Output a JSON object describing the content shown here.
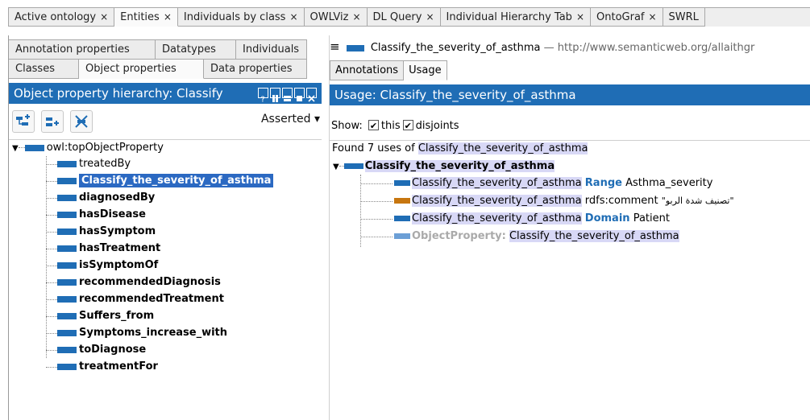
{
  "top_tabs": [
    {
      "label": "Active ontology",
      "close": "×"
    },
    {
      "label": "Entities",
      "close": "×"
    },
    {
      "label": "Individuals by class",
      "close": "×"
    },
    {
      "label": "OWLViz",
      "close": "×"
    },
    {
      "label": "DL Query",
      "close": "×"
    },
    {
      "label": "Individual Hierarchy Tab",
      "close": "×"
    },
    {
      "label": "OntoGraf",
      "close": "×"
    },
    {
      "label": "SWRL",
      "close": ""
    }
  ],
  "left": {
    "subtabs_row1": [
      "Annotation properties",
      "Datatypes",
      "Individuals"
    ],
    "subtabs_row2": [
      "Classes",
      "Object properties",
      "Data properties"
    ],
    "header": "Object property hierarchy: Classify",
    "asserted": "Asserted",
    "tree": {
      "root": "owl:topObjectProperty",
      "children": [
        "treatedBy",
        "Classify_the_severity_of_asthma",
        "diagnosedBy",
        "hasDisease",
        "hasSymptom",
        "hasTreatment",
        "isSymptomOf",
        "recommendedDiagnosis",
        "recommendedTreatment",
        "Suffers_from",
        "Symptoms_increase_with",
        "toDiagnose",
        "treatmentFor"
      ]
    }
  },
  "right": {
    "menu_glyph": "≡",
    "entity_name": "Classify_the_severity_of_asthma",
    "entity_sep": "—",
    "entity_uri": "http://www.semanticweb.org/allaithgr",
    "tabs": [
      "Annotations",
      "Usage"
    ],
    "header": "Usage: Classify_the_severity_of_asthma",
    "show_label": "Show:",
    "show_this": "this",
    "show_disjoints": "disjoints",
    "found_prefix": "Found 7 uses of",
    "found_entity": "Classify_the_severity_of_asthma",
    "usage_root": "Classify_the_severity_of_asthma",
    "usages": [
      {
        "subject": "Classify_the_severity_of_asthma",
        "predicate": "Range",
        "object": "Asthma_severity"
      },
      {
        "subject": "Classify_the_severity_of_asthma",
        "predicate": "rdfs:comment",
        "object": "\"تصنيف شدة الربو\""
      },
      {
        "subject": "Classify_the_severity_of_asthma",
        "predicate": "Domain",
        "object": "Patient"
      },
      {
        "subject": "ObjectProperty:",
        "predicate": "",
        "object": "Classify_the_severity_of_asthma"
      }
    ]
  },
  "colors": {
    "accent": "#1f6db5",
    "selection": "#2b69c2",
    "highlight": "#d8d8f6",
    "annotation_bar": "#c7760f"
  }
}
